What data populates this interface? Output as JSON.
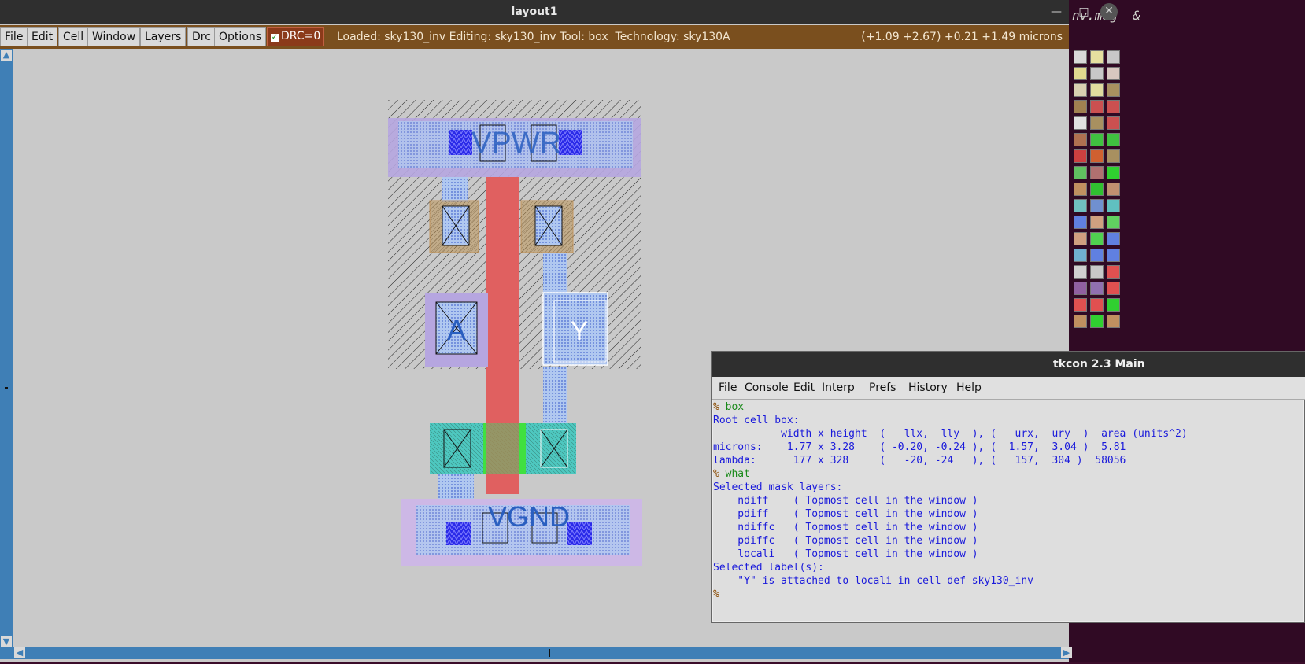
{
  "terminal": {
    "visible_text": "nv.mag  &"
  },
  "window": {
    "title": "layout1",
    "controls": {
      "minimize": "—",
      "maximize": "□",
      "close": "✕"
    }
  },
  "menubar": {
    "items": [
      "File",
      "Edit",
      "Cell",
      "Window",
      "Layers",
      "Drc",
      "Options"
    ],
    "drc_label": "DRC=0",
    "drc_checked": true,
    "status": "Loaded: sky130_inv Editing: sky130_inv Tool: box  Technology: sky130A",
    "coords": "(+1.09 +2.67) +0.21 +1.49 microns"
  },
  "layout": {
    "labels": {
      "vpwr": "VPWR",
      "vgnd": "VGND",
      "a": "A",
      "y": "Y"
    }
  },
  "palette": {
    "colors": [
      "#d8d8d8",
      "#e6e0a0",
      "#c8c8c8",
      "#e0d890",
      "#c8c8c8",
      "#d8c8c0",
      "#d8d0b0",
      "#e0dca0",
      "#a89060",
      "#a08050",
      "#cc5050",
      "#cc5050",
      "#e0e0e0",
      "#a89060",
      "#cc5050",
      "#b07050",
      "#40c040",
      "#40c040",
      "#cc4040",
      "#d06030",
      "#a89060",
      "#60c060",
      "#b07070",
      "#30d030",
      "#c09060",
      "#30c030",
      "#c09070",
      "#70c0c0",
      "#7090d0",
      "#60c0c0",
      "#6080e0",
      "#d0a080",
      "#60d060",
      "#d0a080",
      "#50d050",
      "#6080e0",
      "#70b0d0",
      "#6080e0",
      "#6080e0",
      "#d0d0d0",
      "#c8c8c8",
      "#e05050",
      "#9060a0",
      "#9070b0",
      "#e05050",
      "#e05050",
      "#e05050",
      "#30d030",
      "#c09060",
      "#30d030",
      "#c09060"
    ]
  },
  "tkcon": {
    "title": "tkcon 2.3 Main",
    "menu": [
      "File",
      "Console",
      "Edit",
      "Interp",
      "Prefs",
      "History",
      "Help"
    ],
    "lines": [
      {
        "type": "cmd",
        "prompt": "% ",
        "text": "box"
      },
      {
        "type": "out",
        "text": "Root cell box:"
      },
      {
        "type": "out",
        "text": "           width x height  (   llx,  lly  ), (   urx,  ury  )  area (units^2)"
      },
      {
        "type": "out",
        "text": ""
      },
      {
        "type": "out",
        "text": "microns:    1.77 x 3.28    ( -0.20, -0.24 ), (  1.57,  3.04 )  5.81"
      },
      {
        "type": "out",
        "text": "lambda:      177 x 328     (   -20, -24   ), (   157,  304 )  58056"
      },
      {
        "type": "cmd",
        "prompt": "% ",
        "text": "what"
      },
      {
        "type": "out",
        "text": "Selected mask layers:"
      },
      {
        "type": "out",
        "text": "    ndiff    ( Topmost cell in the window )"
      },
      {
        "type": "out",
        "text": "    pdiff    ( Topmost cell in the window )"
      },
      {
        "type": "out",
        "text": "    ndiffc   ( Topmost cell in the window )"
      },
      {
        "type": "out",
        "text": "    pdiffc   ( Topmost cell in the window )"
      },
      {
        "type": "out",
        "text": "    locali   ( Topmost cell in the window )"
      },
      {
        "type": "out",
        "text": "Selected label(s):"
      },
      {
        "type": "out",
        "text": "    \"Y\" is attached to locali in cell def sky130_inv"
      },
      {
        "type": "cmd",
        "prompt": "% ",
        "text": ""
      }
    ]
  }
}
